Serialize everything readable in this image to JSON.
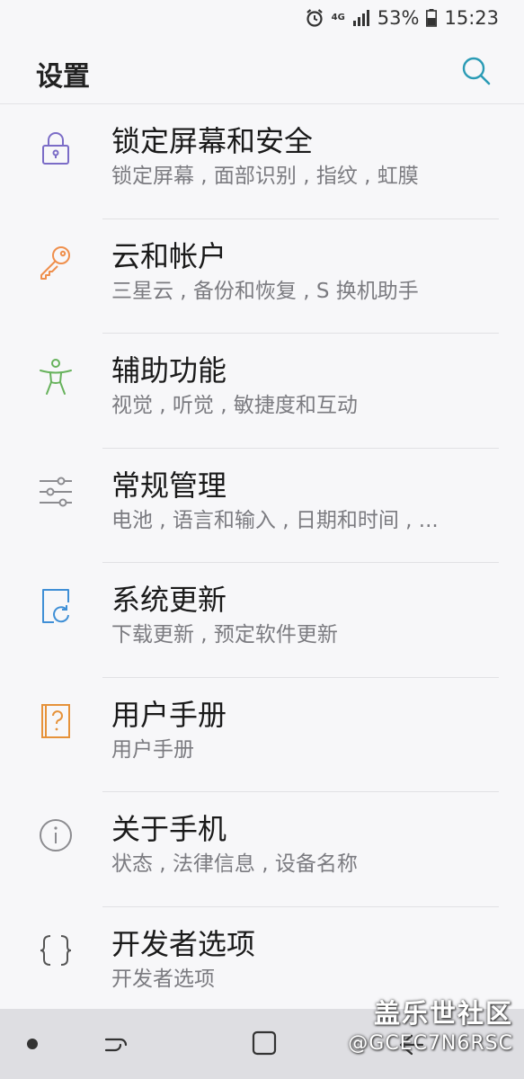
{
  "status_bar": {
    "network": "4G",
    "battery": "53%",
    "time": "15:23",
    "icons": [
      "alarm-icon",
      "network-4g-icon",
      "signal-icon",
      "battery-icon"
    ]
  },
  "header": {
    "title": "设置",
    "search_icon": "search-icon"
  },
  "settings": [
    {
      "title": "锁定屏幕和安全",
      "subtitle": "锁定屏幕 , 面部识别 , 指纹 , 虹膜",
      "icon": "lock-icon",
      "color": "#7b6cc7"
    },
    {
      "title": "云和帐户",
      "subtitle": "三星云 , 备份和恢复 , S 换机助手",
      "icon": "key-icon",
      "color": "#ef8f4c"
    },
    {
      "title": "辅助功能",
      "subtitle": "视觉 , 听觉 , 敏捷度和互动",
      "icon": "accessibility-icon",
      "color": "#67b25c"
    },
    {
      "title": "常规管理",
      "subtitle": "电池 , 语言和输入 , 日期和时间 , ...",
      "icon": "sliders-icon",
      "color": "#8c8c90"
    },
    {
      "title": "系统更新",
      "subtitle": "下载更新 , 预定软件更新",
      "icon": "system-update-icon",
      "color": "#3f8fd6"
    },
    {
      "title": "用户手册",
      "subtitle": "用户手册",
      "icon": "user-manual-icon",
      "color": "#e6923a"
    },
    {
      "title": "关于手机",
      "subtitle": "状态 , 法律信息 , 设备名称",
      "icon": "info-icon",
      "color": "#8c8c90"
    },
    {
      "title": "开发者选项",
      "subtitle": "开发者选项",
      "icon": "developer-braces-icon",
      "color": "#555555"
    }
  ],
  "nav_bar": {
    "icons": [
      "nav-dot-icon",
      "recent-apps-icon",
      "home-icon",
      "back-icon"
    ]
  },
  "watermark": {
    "main": "盖乐世社区",
    "sub": "@GCEC7N6RSC"
  },
  "colors": {
    "background": "#f7f7f9",
    "accent": "#2a9bb5",
    "nav_bar": "#dedee2"
  }
}
